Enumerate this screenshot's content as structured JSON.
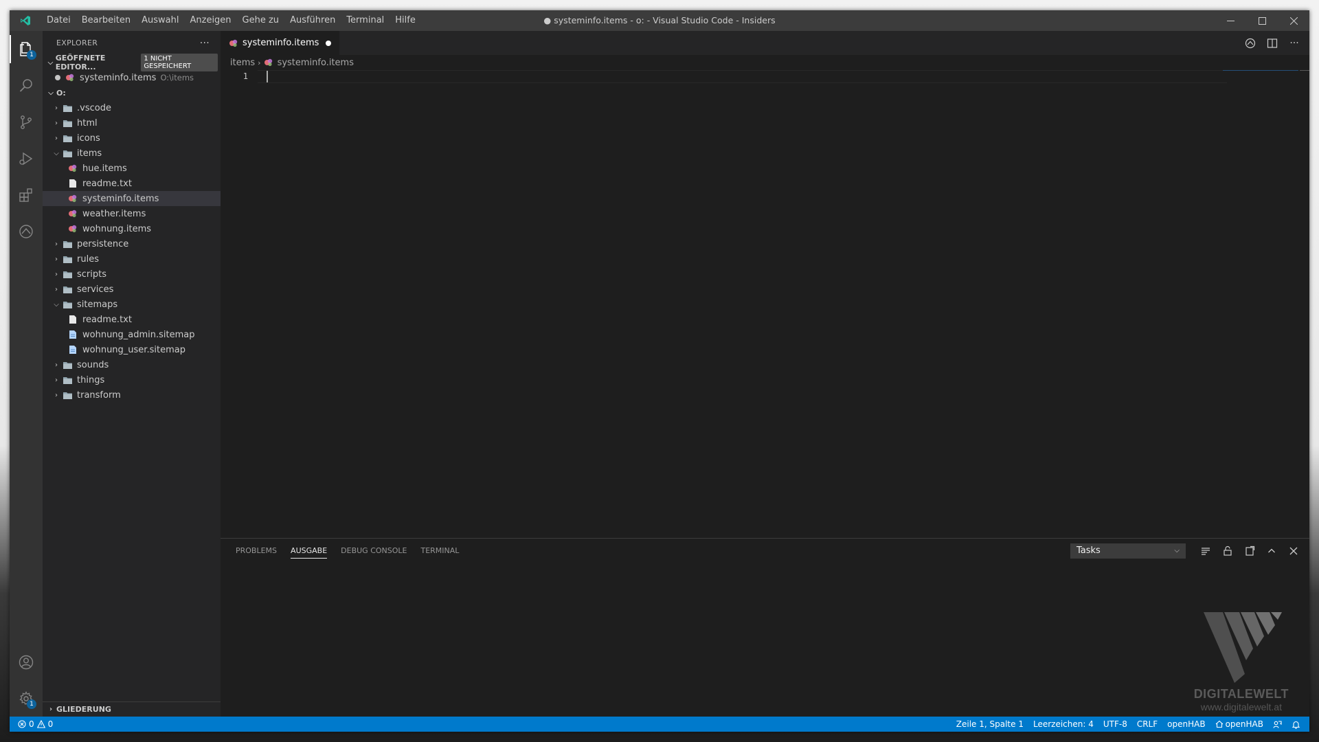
{
  "titlebar": {
    "menu": [
      "Datei",
      "Bearbeiten",
      "Auswahl",
      "Anzeigen",
      "Gehe zu",
      "Ausführen",
      "Terminal",
      "Hilfe"
    ],
    "title": "● systeminfo.items - o: - Visual Studio Code - Insiders"
  },
  "activitybar": {
    "explorer_badge": "1",
    "settings_badge": "1"
  },
  "sidebar": {
    "title": "EXPLORER",
    "more": "···",
    "open_editors": {
      "label": "GEÖFFNETE EDITOR...",
      "badge": "1 NICHT GESPEICHERT",
      "file": "systeminfo.items",
      "path": "O:\\items"
    },
    "root": "O:",
    "tree": [
      {
        "name": ".vscode",
        "type": "folder",
        "open": false
      },
      {
        "name": "html",
        "type": "folder",
        "open": false
      },
      {
        "name": "icons",
        "type": "folder",
        "open": false
      },
      {
        "name": "items",
        "type": "folder",
        "open": true
      },
      {
        "name": "hue.items",
        "type": "items"
      },
      {
        "name": "readme.txt",
        "type": "txt"
      },
      {
        "name": "systeminfo.items",
        "type": "items"
      },
      {
        "name": "weather.items",
        "type": "items"
      },
      {
        "name": "wohnung.items",
        "type": "items"
      },
      {
        "name": "persistence",
        "type": "folder",
        "open": false
      },
      {
        "name": "rules",
        "type": "folder",
        "open": false
      },
      {
        "name": "scripts",
        "type": "folder",
        "open": false
      },
      {
        "name": "services",
        "type": "folder",
        "open": false
      },
      {
        "name": "sitemaps",
        "type": "folder",
        "open": true
      },
      {
        "name": "readme.txt",
        "type": "txt"
      },
      {
        "name": "wohnung_admin.sitemap",
        "type": "sitemap"
      },
      {
        "name": "wohnung_user.sitemap",
        "type": "sitemap"
      },
      {
        "name": "sounds",
        "type": "folder",
        "open": false
      },
      {
        "name": "things",
        "type": "folder",
        "open": false
      },
      {
        "name": "transform",
        "type": "folder",
        "open": false
      }
    ],
    "outline": "GLIEDERUNG"
  },
  "editor": {
    "tab": "systeminfo.items",
    "breadcrumb": [
      "items",
      "systeminfo.items"
    ],
    "line_number": "1"
  },
  "panel": {
    "tabs": [
      "PROBLEMS",
      "AUSGABE",
      "DEBUG CONSOLE",
      "TERMINAL"
    ],
    "active_tab": "AUSGABE",
    "select_value": "Tasks"
  },
  "watermark": {
    "name": "DIGITALEWELT",
    "url": "www.digitalewelt.at"
  },
  "statusbar": {
    "errors": "0",
    "warnings": "0",
    "position": "Zeile 1, Spalte 1",
    "indent": "Leerzeichen: 4",
    "encoding": "UTF-8",
    "eol": "CRLF",
    "language": "openHAB",
    "openhab": "openHAB"
  },
  "colors": {
    "accent": "#007acc",
    "items_icon": "#e06c75",
    "folder_icon": "#90a4ae"
  }
}
